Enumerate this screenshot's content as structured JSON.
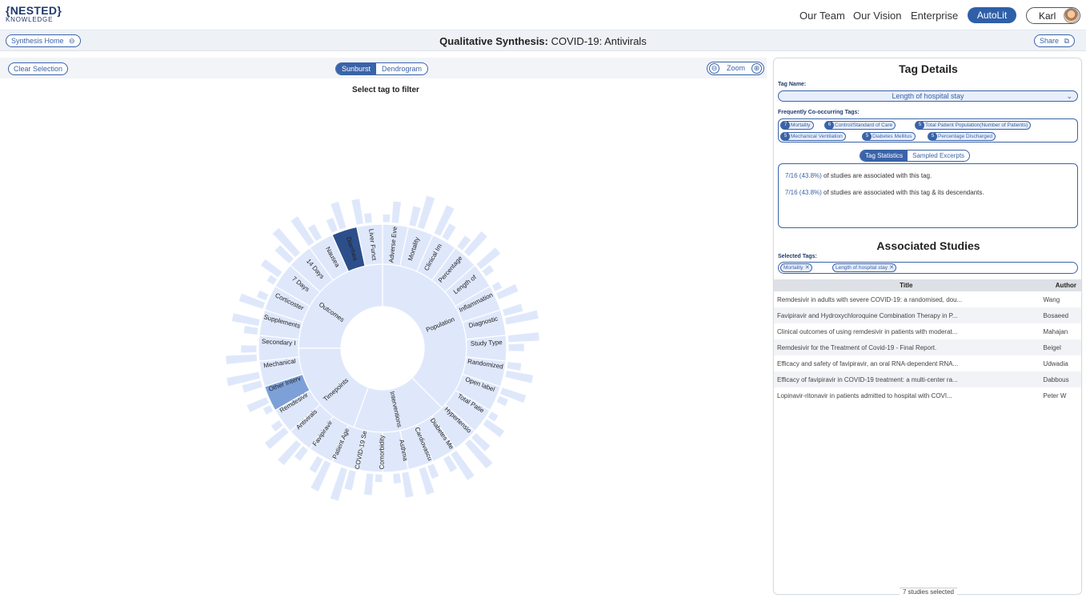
{
  "brand": {
    "line1": "NESTED",
    "line2": "KNOWLEDGE"
  },
  "nav": {
    "links": [
      "Our Team",
      "Our Vision",
      "Enterprise"
    ],
    "autolit": "AutoLit",
    "user": "Karl"
  },
  "subheader": {
    "home_button": "Synthesis Home",
    "title_bold": "Qualitative Synthesis:",
    "title_rest": " COVID-19: Antivirals",
    "share_button": "Share"
  },
  "left": {
    "clear_selection": "Clear Selection",
    "view_tabs": [
      "Sunburst",
      "Dendrogram"
    ],
    "active_view": "Sunburst",
    "zoom_label": "Zoom",
    "zoom_out": "⊖",
    "zoom_in": "⊕",
    "hint": "Select tag to filter"
  },
  "sunburst": {
    "inner_labels": [
      "Outcomes",
      "Population",
      "Interventions",
      "Timepoints"
    ],
    "outer_labels": [
      "Adverse Eve",
      "Mortality",
      "Clinical Im",
      "Percentage",
      "Length of",
      "Inflammation",
      "Diagnostic",
      "Study Type",
      "Randomized",
      "Open label",
      "Total Patie",
      "Hypertensio",
      "Diabetes Me",
      "Cardiovascu",
      "Asthma",
      "Comorbidity",
      "COVID-19 Se",
      "Patient Age",
      "Favipiravir",
      "Antivirals",
      "Remdesivir",
      "Other Interv",
      "Mechanical",
      "Secondary I",
      "Supplements",
      "Corticoster",
      "7 Days",
      "14 Days",
      "Nausea",
      "Diarrhea",
      "Liver Funct"
    ]
  },
  "tag_details": {
    "title": "Tag Details",
    "tag_name_label": "Tag Name:",
    "tag_name": "Length of hospital stay",
    "cooc_label": "Frequently Co-occurring Tags:",
    "cooc_tags": [
      {
        "count": "7",
        "name": "Mortality"
      },
      {
        "count": "6",
        "name": "Control/Standard of Care"
      },
      {
        "count": "5",
        "name": "Total Patient Population(Number of Patients)"
      },
      {
        "count": "5",
        "name": "Mechanical Ventilation"
      },
      {
        "count": "5",
        "name": "Diabetes Mellitus"
      },
      {
        "count": "5",
        "name": "Percentage Discharged"
      }
    ],
    "stat_tabs": [
      "Tag Statistics",
      "Sampled Excerpts"
    ],
    "active_stat_tab": "Tag Statistics",
    "stat1_value": "7/16 (43.8%)",
    "stat1_text": " of studies are associated with this tag.",
    "stat2_value": "7/16 (43.8%)",
    "stat2_text": " of studies are associated with this tag & its descendants."
  },
  "associated": {
    "title": "Associated Studies",
    "selected_label": "Selected Tags:",
    "selected_tags": [
      "Mortality",
      "Length of hospital stay"
    ],
    "columns": [
      "Title",
      "Author"
    ],
    "rows": [
      {
        "title": "Remdesivir in adults with severe COVID-19: a randomised, dou...",
        "author": "Wang"
      },
      {
        "title": "Favipiravir and Hydroxychloroquine Combination Therapy in P...",
        "author": "Bosaeed"
      },
      {
        "title": "Clinical outcomes of using remdesivir in patients with moderat...",
        "author": "Mahajan"
      },
      {
        "title": "Remdesivir for the Treatment of Covid-19 - Final Report.",
        "author": "Beigel"
      },
      {
        "title": "Efficacy and safety of favipiravir, an oral RNA-dependent RNA...",
        "author": "Udwadia"
      },
      {
        "title": "Efficacy of favipiravir in COVID-19 treatment: a multi-center ra...",
        "author": "Dabbous"
      },
      {
        "title": "Lopinavir-ritonavir in patients admitted to hospital with COVI...",
        "author": "Peter W"
      }
    ],
    "footer": "7 studies selected"
  },
  "colors": {
    "accent": "#3a63a8",
    "segment": "#dfe8fb",
    "selected": "#2c4f8c",
    "highlight": "#7da0d8"
  }
}
